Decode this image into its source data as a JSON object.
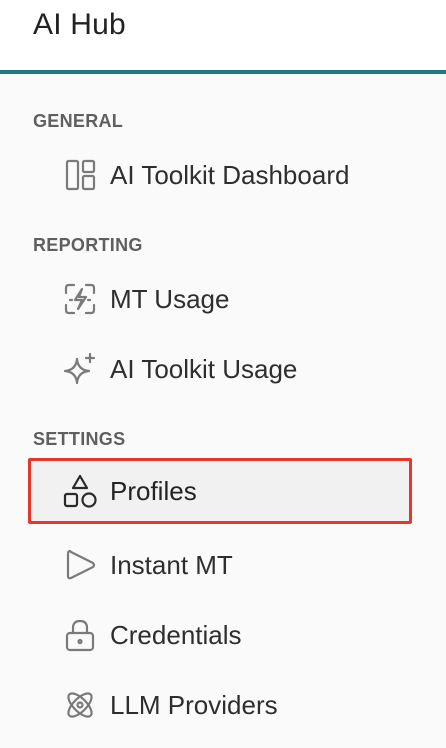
{
  "app": {
    "title": "AI Hub",
    "accent_color": "#1c7a80",
    "selection_color": "#e5372b"
  },
  "sections": {
    "general": {
      "label": "GENERAL",
      "items": [
        {
          "label": "AI Toolkit Dashboard",
          "icon": "dashboard-layout-icon"
        }
      ]
    },
    "reporting": {
      "label": "REPORTING",
      "items": [
        {
          "label": "MT Usage",
          "icon": "lightning-usage-icon"
        },
        {
          "label": "AI Toolkit Usage",
          "icon": "sparkle-icon"
        }
      ]
    },
    "settings": {
      "label": "SETTINGS",
      "items": [
        {
          "label": "Profiles",
          "icon": "shapes-icon",
          "selected": true
        },
        {
          "label": "Instant MT",
          "icon": "play-icon"
        },
        {
          "label": "Credentials",
          "icon": "lock-icon"
        },
        {
          "label": "LLM Providers",
          "icon": "atom-icon"
        }
      ]
    }
  }
}
